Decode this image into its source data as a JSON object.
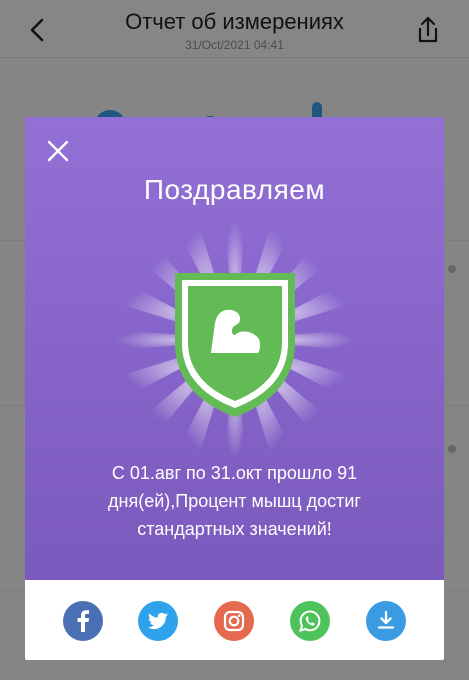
{
  "header": {
    "title": "Отчет об измерениях",
    "date": "31/Oct/2021 04:41",
    "back_icon": "chevron-left-icon",
    "share_icon": "share-icon"
  },
  "modal": {
    "title": "Поздравляем",
    "message_lines": [
      "С 01.авг по 31.окт прошло 91",
      "дня(ей),Процент мышц достиг",
      "стандартных значений!"
    ],
    "close_icon": "close-icon",
    "badge_icon": "muscle-badge-icon"
  },
  "share": {
    "items": [
      {
        "name": "facebook",
        "icon": "facebook-icon",
        "color": "#4a6fb3"
      },
      {
        "name": "twitter",
        "icon": "twitter-icon",
        "color": "#2ea2ea"
      },
      {
        "name": "instagram",
        "icon": "instagram-icon",
        "color": "#e5694f"
      },
      {
        "name": "whatsapp",
        "icon": "whatsapp-icon",
        "color": "#4fc35b"
      },
      {
        "name": "download",
        "icon": "download-icon",
        "color": "#3a9be3"
      }
    ]
  },
  "colors": {
    "modal_purple": "#8a68cc",
    "badge_green": "#63bb56",
    "overlay": "#000000"
  }
}
